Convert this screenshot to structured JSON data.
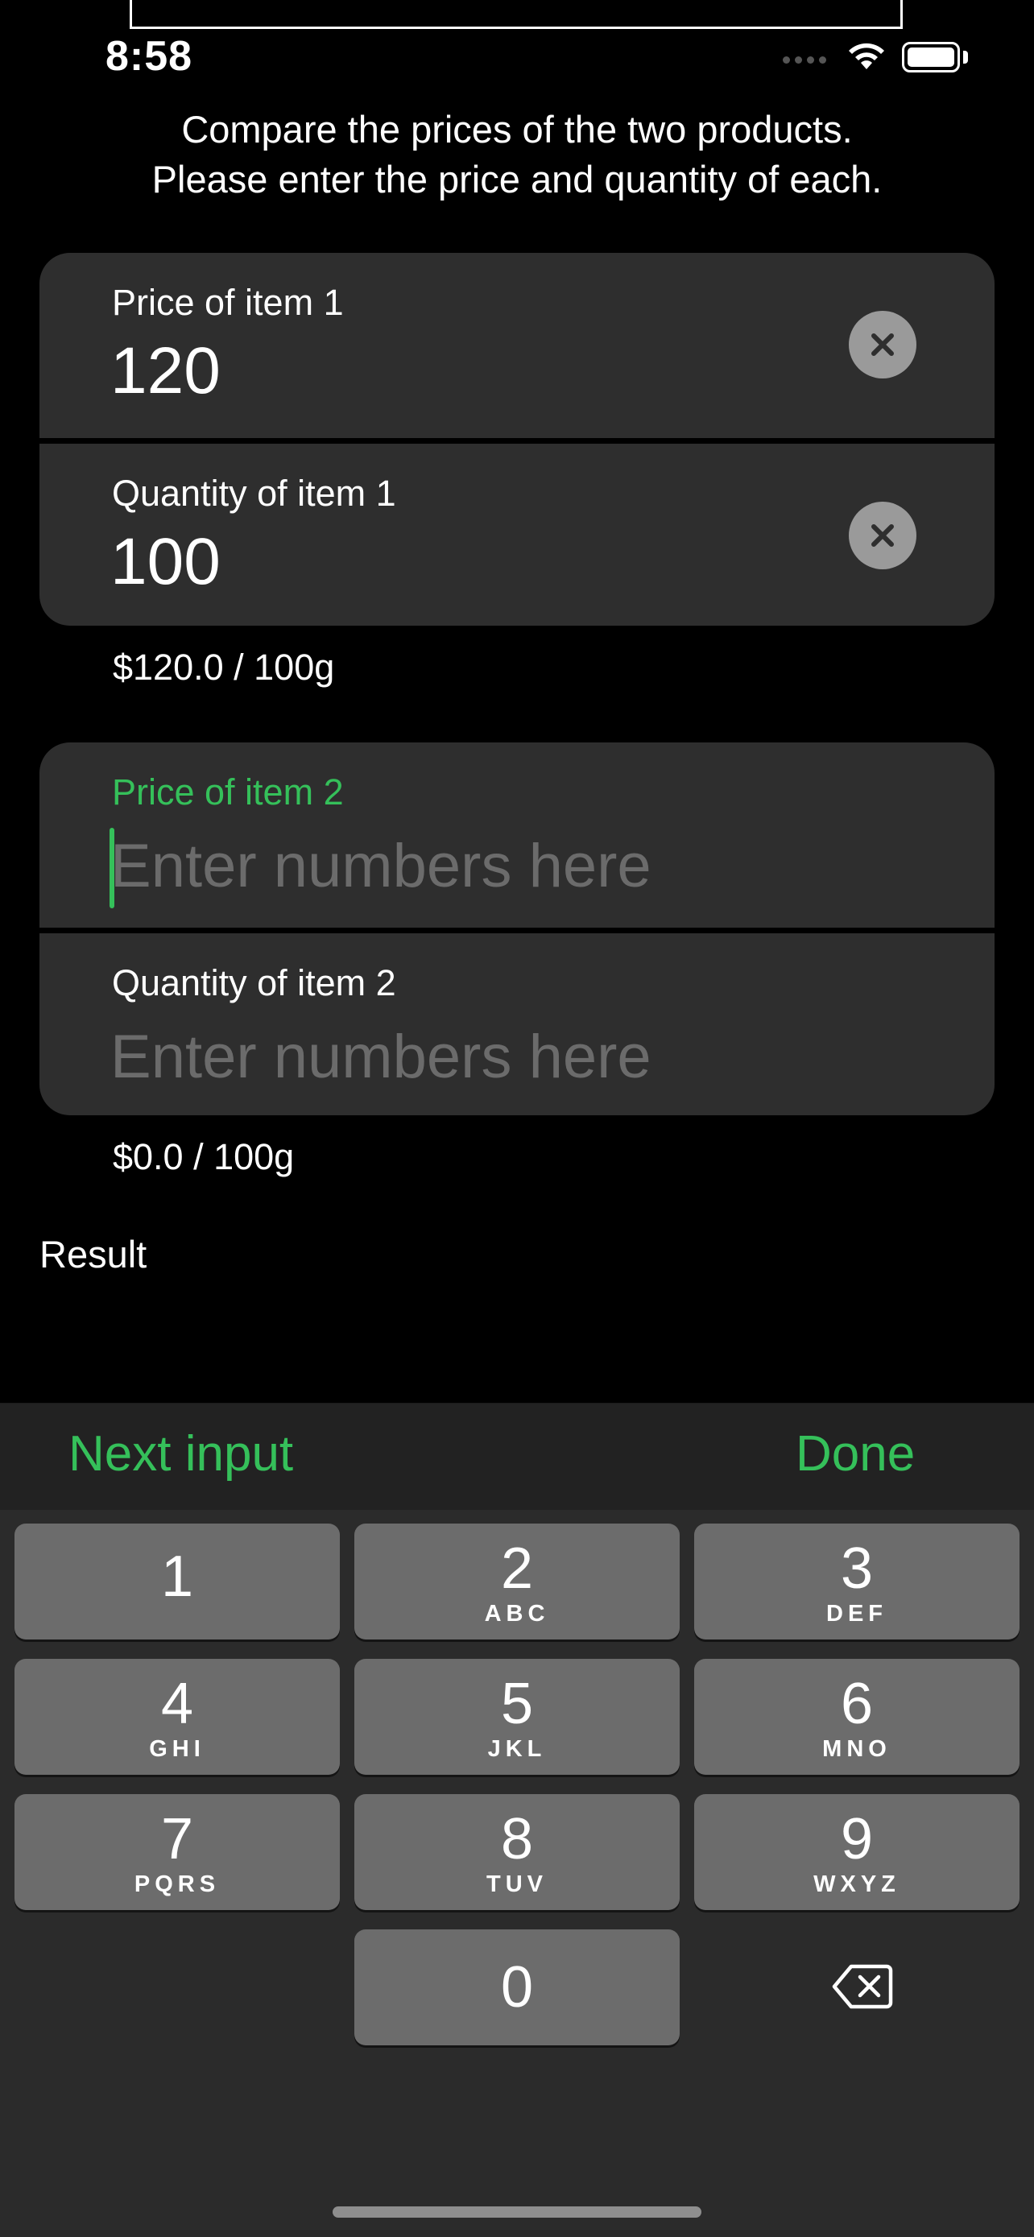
{
  "status_bar": {
    "time": "8:58"
  },
  "intro": {
    "line1": "Compare the prices of the two products.",
    "line2": "Please enter the price and quantity of each."
  },
  "item1": {
    "price_label": "Price of item 1",
    "price_value": "120",
    "quantity_label": "Quantity of item 1",
    "quantity_value": "100",
    "unit_price": "$120.0 / 100g"
  },
  "item2": {
    "price_label": "Price of item 2",
    "price_placeholder": "Enter numbers here",
    "quantity_label": "Quantity of item 2",
    "quantity_placeholder": "Enter numbers here",
    "unit_price": "$0.0 / 100g"
  },
  "result_label": "Result",
  "keyboard": {
    "toolbar": {
      "next": "Next input",
      "done": "Done"
    },
    "keys": [
      {
        "digit": "1",
        "letters": ""
      },
      {
        "digit": "2",
        "letters": "ABC"
      },
      {
        "digit": "3",
        "letters": "DEF"
      },
      {
        "digit": "4",
        "letters": "GHI"
      },
      {
        "digit": "5",
        "letters": "JKL"
      },
      {
        "digit": "6",
        "letters": "MNO"
      },
      {
        "digit": "7",
        "letters": "PQRS"
      },
      {
        "digit": "8",
        "letters": "TUV"
      },
      {
        "digit": "9",
        "letters": "WXYZ"
      },
      {
        "digit": "0",
        "letters": ""
      }
    ]
  },
  "colors": {
    "accent": "#35c05a",
    "card": "#2e2e2e",
    "key": "#6c6c6c",
    "keyboard_bg": "#2b2b2b"
  }
}
